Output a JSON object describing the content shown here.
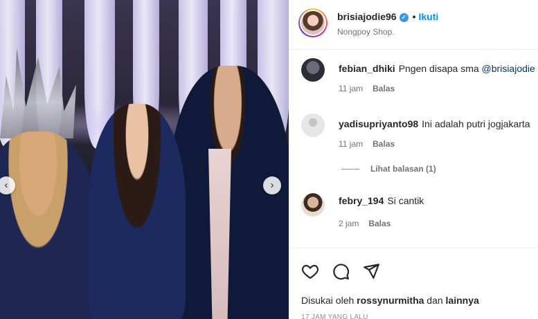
{
  "header": {
    "username": "brisiajodie96",
    "verified_mark": "✓",
    "separator": "•",
    "follow_label": "Ikuti",
    "subtitle": "Nongpoy Shop."
  },
  "comments": [
    {
      "username": "febian_dhiki",
      "text": "Pngen disapa sma",
      "mention": "@brisiajodie",
      "time": "11 jam",
      "reply_label": "Balas",
      "avatar_color": "#3d3d4d"
    },
    {
      "username": "yadisupriyanto98",
      "text": "Ini adalah putri jogjakarta",
      "mention": "",
      "time": "11 jam",
      "reply_label": "Balas",
      "avatar_color": "#dbdbdb",
      "view_replies": "Lihat balasan (1)"
    },
    {
      "username": "febry_194",
      "text": "Si cantik",
      "mention": "",
      "time": "2 jam",
      "reply_label": "Balas",
      "avatar_color": "#c9a98d"
    }
  ],
  "actions": {
    "like_icon": "heart-icon",
    "comment_icon": "comment-icon",
    "share_icon": "share-icon"
  },
  "likes": {
    "prefix": "Disukai oleh",
    "user": "rossynurmitha",
    "conjunction": "dan",
    "others": "lainnya"
  },
  "timestamp": "17 JAM YANG LALU",
  "photo": {
    "prev_icon": "‹",
    "next_icon": "›"
  },
  "colors": {
    "accent": "#0095f6",
    "verified": "#3897f0",
    "muted": "#737373"
  }
}
